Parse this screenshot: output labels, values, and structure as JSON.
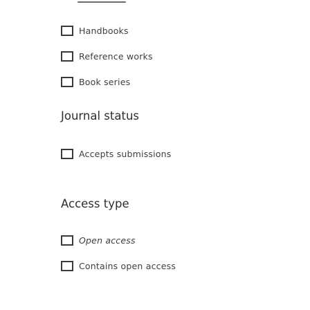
{
  "groups": [
    {
      "title": "",
      "options": [
        {
          "label": "Handbooks",
          "checked": false
        },
        {
          "label": "Reference works",
          "checked": false
        },
        {
          "label": "Book series",
          "checked": false
        }
      ]
    },
    {
      "title": "Journal status",
      "options": [
        {
          "label": "Accepts submissions",
          "checked": false
        }
      ]
    },
    {
      "title": "Access type",
      "options": [
        {
          "label": "Open access",
          "checked": false
        },
        {
          "label": "Contains open access",
          "checked": false
        }
      ]
    }
  ]
}
